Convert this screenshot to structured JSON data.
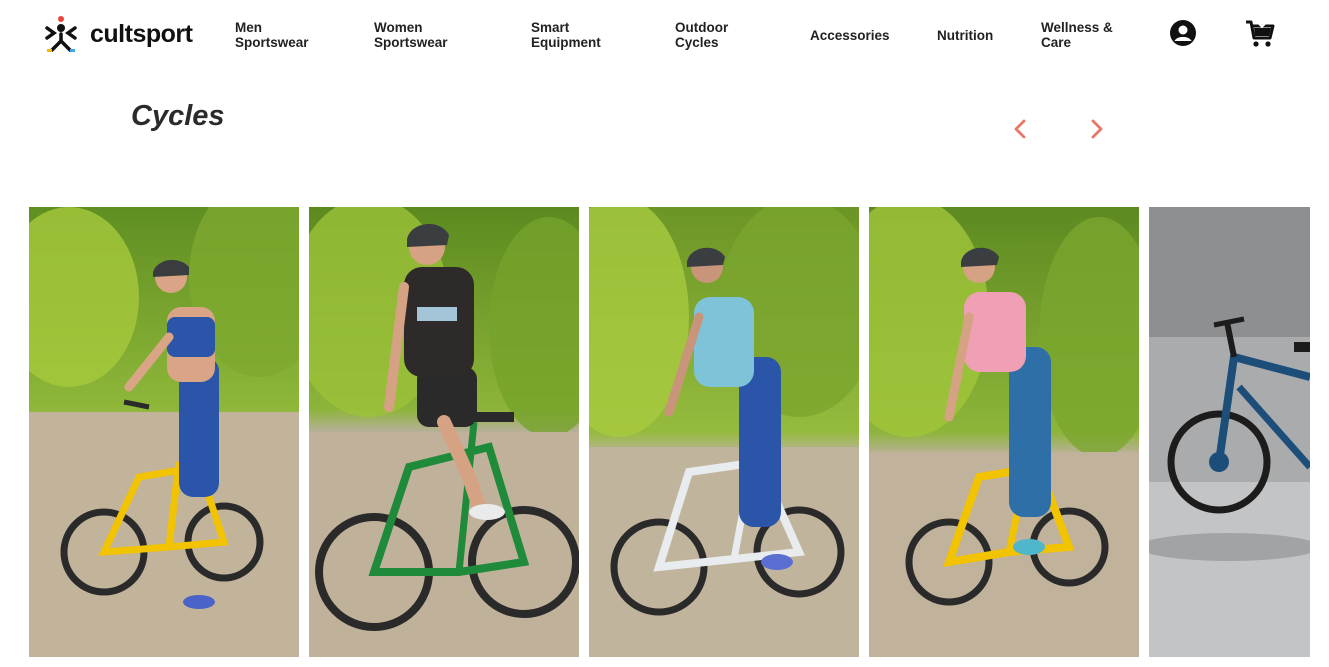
{
  "brand": {
    "name": "cultsport"
  },
  "nav": {
    "items": [
      {
        "line1": "Men",
        "line2": "Sportswear"
      },
      {
        "line1": "Women",
        "line2": "Sportswear"
      },
      {
        "line1": "Smart",
        "line2": "Equipment"
      },
      {
        "line1": "Outdoor",
        "line2": "Cycles"
      },
      {
        "line1": "Accessories",
        "line2": ""
      },
      {
        "line1": "Nutrition",
        "line2": ""
      },
      {
        "line1": "Wellness &",
        "line2": "Care"
      }
    ],
    "icons": [
      "account-icon",
      "cart-icon"
    ]
  },
  "section": {
    "title": "Cycles",
    "prev_icon": "chevron-left-icon",
    "next_icon": "chevron-right-icon",
    "arrow_color": "#e8776a"
  },
  "carousel": {
    "cards": [
      {
        "frame_color": "#f2c300",
        "apparel": "#2a55a8",
        "top": "#2a55a8"
      },
      {
        "frame_color": "#1f8a3a",
        "apparel": "#2b2b2b",
        "top": "#2f2a2a"
      },
      {
        "frame_color": "#e9ecef",
        "apparel": "#2a55a8",
        "top": "#7fc3d9"
      },
      {
        "frame_color": "#f2c300",
        "apparel": "#2e6fa8",
        "top": "#efa0b4"
      },
      {
        "frame_color": "#1d4e7a",
        "apparel": "",
        "top": ""
      }
    ]
  },
  "colors": {
    "brand_red": "#e8463c",
    "brand_yellow": "#f6b90a",
    "brand_blue": "#3fa8e0"
  }
}
